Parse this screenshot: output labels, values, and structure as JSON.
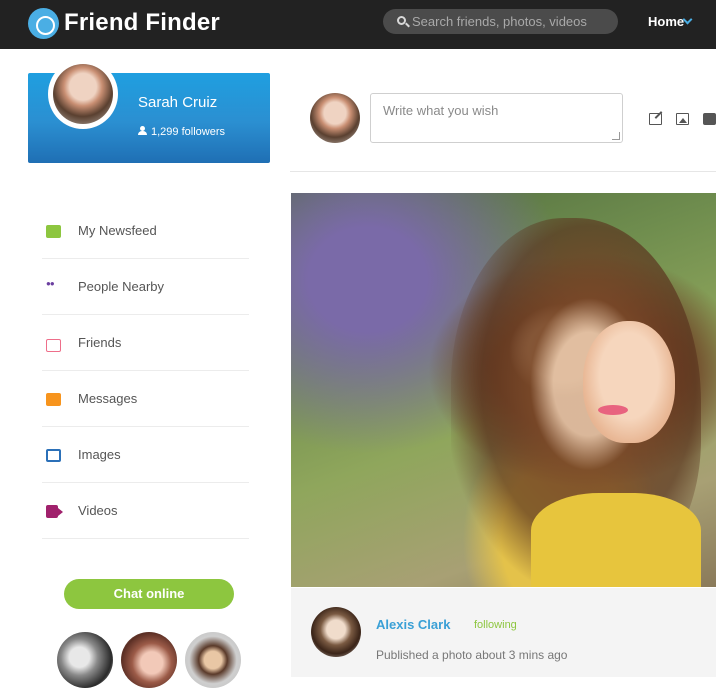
{
  "header": {
    "brand": "Friend Finder",
    "search_placeholder": "Search friends, photos, videos",
    "nav_home": "Home"
  },
  "profile": {
    "name": "Sarah Cruiz",
    "followers": "1,299 followers"
  },
  "menu": {
    "items": [
      {
        "label": "My Newsfeed",
        "icon": "newsfeed-icon",
        "color": "#8dc63f"
      },
      {
        "label": "People Nearby",
        "icon": "people-icon",
        "color": "#6b3fa0"
      },
      {
        "label": "Friends",
        "icon": "friends-icon",
        "color": "#ee6e8a"
      },
      {
        "label": "Messages",
        "icon": "messages-icon",
        "color": "#f7941d"
      },
      {
        "label": "Images",
        "icon": "images-icon",
        "color": "#2b70b8"
      },
      {
        "label": "Videos",
        "icon": "videos-icon",
        "color": "#a0216c"
      }
    ]
  },
  "chat": {
    "label": "Chat online"
  },
  "composer": {
    "placeholder": "Write what you wish"
  },
  "post": {
    "author": "Alexis Clark",
    "follow_status": "following",
    "time": "Published a photo about 3 mins ago"
  },
  "colors": {
    "accent": "#4aaee4",
    "green": "#8dc63f",
    "topbar": "#222222"
  }
}
